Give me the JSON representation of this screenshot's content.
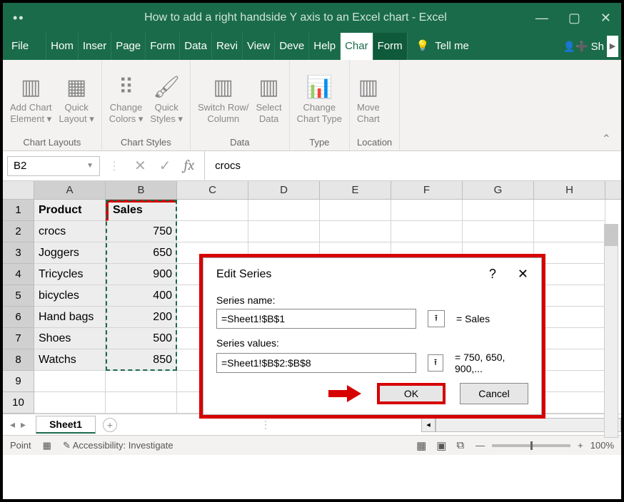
{
  "titlebar": {
    "title": "How to add a right handside Y axis to an Excel chart  -  Excel"
  },
  "tabs": {
    "file": "File",
    "home": "Hom",
    "insert": "Inser",
    "page": "Page",
    "form": "Form",
    "data": "Data",
    "review": "Revi",
    "view": "View",
    "dev": "Deve",
    "help": "Help",
    "chart": "Char",
    "format": "Form",
    "tellme": "Tell me",
    "share": "Sh"
  },
  "ribbon": {
    "add_chart_element": "Add Chart\nElement ▾",
    "quick_layout": "Quick\nLayout ▾",
    "change_colors": "Change\nColors ▾",
    "quick_styles": "Quick\nStyles ▾",
    "switch_rc": "Switch Row/\nColumn",
    "select_data": "Select\nData",
    "change_type": "Change\nChart Type",
    "move_chart": "Move\nChart",
    "g_layouts": "Chart Layouts",
    "g_styles": "Chart Styles",
    "g_data": "Data",
    "g_type": "Type",
    "g_location": "Location"
  },
  "formula_bar": {
    "cell_ref": "B2",
    "value": "crocs"
  },
  "sheet": {
    "columns": [
      "A",
      "B",
      "C",
      "D",
      "E",
      "F",
      "G",
      "H"
    ],
    "header": {
      "product": "Product",
      "sales": "Sales"
    },
    "rows": [
      {
        "n": "1"
      },
      {
        "n": "2",
        "a": "crocs",
        "b": "750"
      },
      {
        "n": "3",
        "a": "Joggers",
        "b": "650"
      },
      {
        "n": "4",
        "a": "Tricycles",
        "b": "900"
      },
      {
        "n": "5",
        "a": "bicycles",
        "b": "400"
      },
      {
        "n": "6",
        "a": "Hand bags",
        "b": "200"
      },
      {
        "n": "7",
        "a": "Shoes",
        "b": "500"
      },
      {
        "n": "8",
        "a": "Watchs",
        "b": "850"
      },
      {
        "n": "9"
      },
      {
        "n": "10"
      }
    ],
    "tab_name": "Sheet1"
  },
  "dialog": {
    "title": "Edit Series",
    "series_name_label": "Series name:",
    "series_name_value": "=Sheet1!$B$1",
    "series_name_result": "= Sales",
    "series_values_label": "Series values:",
    "series_values_value": "=Sheet1!$B$2:$B$8",
    "series_values_result": "= 750, 650, 900,...",
    "ok": "OK",
    "cancel": "Cancel"
  },
  "status": {
    "mode": "Point",
    "accessibility": "Accessibility: Investigate",
    "zoom": "100%"
  },
  "chart_data": {
    "type": "table",
    "columns": [
      "Product",
      "Sales"
    ],
    "rows": [
      [
        "crocs",
        750
      ],
      [
        "Joggers",
        650
      ],
      [
        "Tricycles",
        900
      ],
      [
        "bicycles",
        400
      ],
      [
        "Hand bags",
        200
      ],
      [
        "Shoes",
        500
      ],
      [
        "Watchs",
        850
      ]
    ]
  }
}
